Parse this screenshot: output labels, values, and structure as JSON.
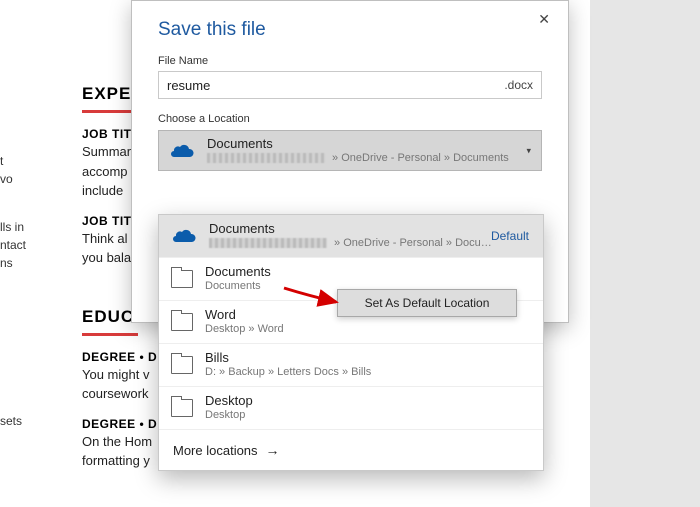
{
  "dialog": {
    "title": "Save this file",
    "filename_label": "File Name",
    "filename_value": "resume",
    "file_extension": ".docx",
    "location_label": "Choose a Location",
    "selected_location": {
      "name": "Documents",
      "path_suffix": " » OneDrive - Personal » Documents"
    },
    "locations": [
      {
        "name": "Documents",
        "path_suffix": " » OneDrive - Personal » Docu…",
        "icon": "onedrive",
        "default_tag": "Default"
      },
      {
        "name": "Documents",
        "path": "Documents",
        "icon": "folder"
      },
      {
        "name": "Word",
        "path": "Desktop » Word",
        "icon": "folder"
      },
      {
        "name": "Bills",
        "path": "D: » Backup » Letters  Docs » Bills",
        "icon": "folder"
      },
      {
        "name": "Desktop",
        "path": "Desktop",
        "icon": "folder"
      }
    ],
    "more_locations": "More locations",
    "set_default_button": "Set As Default Location"
  },
  "background": {
    "experience_heading": "EXPER",
    "education_heading": "EDUCA",
    "job_title_1": "JOB TITL",
    "job_body_1a": "Summar",
    "job_body_1b": "accomp",
    "job_body_1c": "include",
    "job_title_2": "JOB TITL",
    "job_body_2a": "Think al",
    "job_body_2b": "you bala",
    "degree_1": "DEGREE  •  D",
    "degree_body_1a": "You might v",
    "degree_body_1b": "coursework",
    "degree_2": "DEGREE  •  D",
    "degree_body_2a": "On the Hom",
    "degree_body_2b": "formatting y",
    "left_frag_1": "t",
    "left_frag_2": "vo",
    "left_frag_3": "lls in",
    "left_frag_4": "ntact",
    "left_frag_5": "ns",
    "left_frag_6": "sets"
  }
}
